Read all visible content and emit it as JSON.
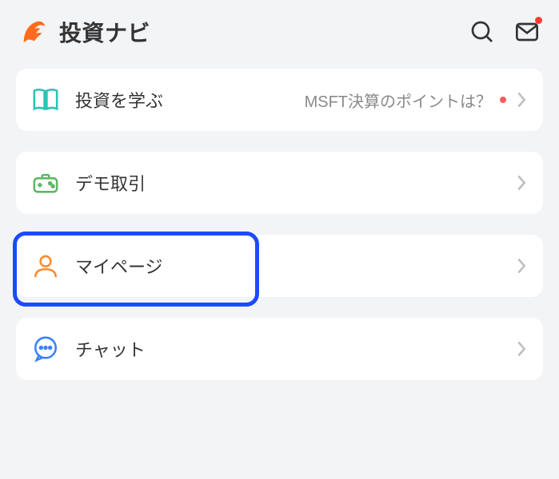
{
  "header": {
    "title": "投資ナビ"
  },
  "menu": {
    "items": [
      {
        "label": "投資を学ぶ",
        "subtext": "MSFT決算のポイントは？",
        "hasRedDot": true
      },
      {
        "label": "デモ取引"
      },
      {
        "label": "マイページ"
      },
      {
        "label": "チャット"
      }
    ]
  },
  "colors": {
    "brand": "#ff6b1a",
    "highlight": "#1b4bff",
    "teal": "#2bc4b5",
    "green": "#5fb764",
    "blue": "#3b82f6"
  }
}
